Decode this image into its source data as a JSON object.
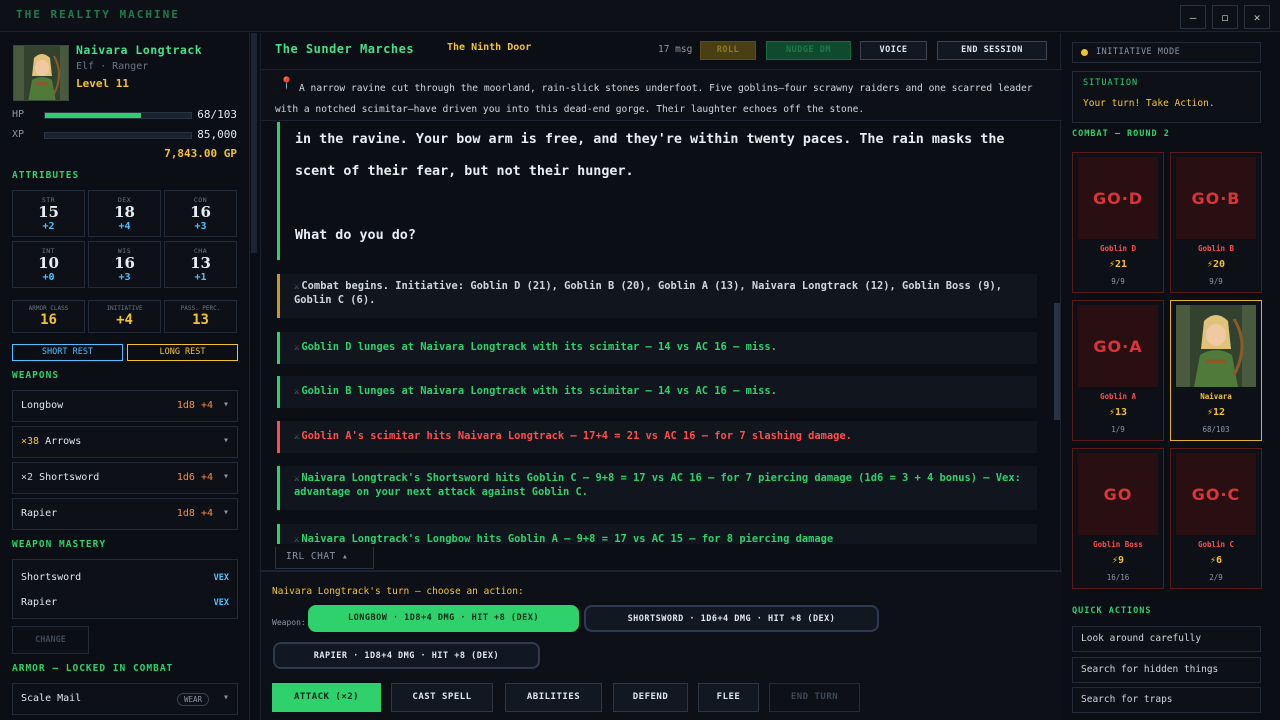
{
  "window": {
    "title": "THE REALITY MACHINE",
    "min_label": "—",
    "max_label": "◻",
    "close_label": "✕"
  },
  "character": {
    "name": "Naivara Longtrack",
    "subtitle": "Elf · Ranger",
    "level": "Level 11",
    "hp_label": "HP",
    "hp_value": "68/103",
    "hp_fraction": 0.66,
    "xp_label": "XP",
    "xp_value": "85,000",
    "xp_fraction": 0.0,
    "gold": "7,843.00 GP"
  },
  "attributes": {
    "section": "ATTRIBUTES",
    "items": [
      {
        "label": "STR",
        "value": "15",
        "mod": "+2"
      },
      {
        "label": "DEX",
        "value": "18",
        "mod": "+4"
      },
      {
        "label": "CON",
        "value": "16",
        "mod": "+3"
      },
      {
        "label": "INT",
        "value": "10",
        "mod": "+0"
      },
      {
        "label": "WIS",
        "value": "16",
        "mod": "+3"
      },
      {
        "label": "CHA",
        "value": "13",
        "mod": "+1"
      }
    ],
    "defense": [
      {
        "label": "ARMOR CLASS",
        "value": "16"
      },
      {
        "label": "INITIATIVE",
        "value": "+4"
      },
      {
        "label": "PASS. PERC.",
        "value": "13"
      }
    ]
  },
  "rest": {
    "short": "SHORT REST",
    "long": "LONG REST"
  },
  "weapons": {
    "section": "WEAPONS",
    "items": [
      {
        "qty": "",
        "name": "Longbow",
        "dmg": "1d8 +4"
      },
      {
        "qty": "×38",
        "name": "Arrows",
        "dmg": ""
      },
      {
        "qty": "×2",
        "name": "Shortsword",
        "dmg": "1d6 +4"
      },
      {
        "qty": "",
        "name": "Rapier",
        "dmg": "1d8 +4"
      }
    ],
    "chevron": "▾"
  },
  "mastery": {
    "section": "WEAPON MASTERY",
    "items": [
      {
        "name": "Shortsword",
        "value": "VEX"
      },
      {
        "name": "Rapier",
        "value": "VEX"
      }
    ],
    "change": "CHANGE"
  },
  "armor": {
    "section": "ARMOR — LOCKED IN COMBAT",
    "name": "Scale Mail",
    "badge": "WEAR",
    "chevron": "▾"
  },
  "session": {
    "campaign": "The Sunder Marches",
    "chapter": "The Ninth Door",
    "msg_count": "17 msg",
    "roll": "ROLL",
    "nudge": "NUDGE DM",
    "voice": "VOICE",
    "end": "END SESSION"
  },
  "scene": {
    "pin": "📍",
    "text": "A narrow ravine cut through the moorland, rain-slick stones underfoot. Five goblins—four scrawny raiders and one scarred leader with a notched scimitar—have driven you into this dead-end gorge. Their laughter echoes off the stone."
  },
  "narration": {
    "line1": "in the ravine. Your bow arm is free, and they're within twenty paces. The rain masks the",
    "line2": "scent of their fear, but not their hunger.",
    "line3": "What do you do?"
  },
  "log": [
    {
      "icon": "⚔",
      "text": "Combat begins. Initiative: Goblin D (21), Goblin B (20), Goblin A (13), Naivara Longtrack (12), Goblin Boss (9), Goblin C (6)."
    },
    {
      "icon": "⚔",
      "text": "Goblin D lunges at Naivara Longtrack with its scimitar — 14 vs AC 16 — miss."
    },
    {
      "icon": "⚔",
      "text": "Goblin B lunges at Naivara Longtrack with its scimitar — 14 vs AC 16 — miss."
    },
    {
      "icon": "⚔",
      "text": "Goblin A's scimitar hits Naivara Longtrack — 17+4 = 21 vs AC 16 — for 7 slashing damage."
    },
    {
      "icon": "⚔",
      "text": "Naivara Longtrack's Shortsword hits Goblin C — 9+8 = 17 vs AC 16 — for 7 piercing damage (1d6 = 3 + 4 bonus) — Vex: advantage on your next attack against Goblin C."
    },
    {
      "icon": "⚔",
      "text": "Naivara Longtrack's Longbow hits Goblin A — 9+8 = 17 vs AC 15 — for 8 piercing damage"
    }
  ],
  "irl_chat": "IRL CHAT  ▴",
  "actions": {
    "turn_label": "Naivara Longtrack's turn — choose an action:",
    "weapon_label": "Weapon:",
    "weapons": [
      "LONGBOW · 1D8+4 DMG · HIT +8 (DEX)",
      "SHORTSWORD · 1D6+4 DMG · HIT +8 (DEX)",
      "RAPIER · 1D8+4 DMG · HIT +8 (DEX)"
    ],
    "buttons": {
      "attack": "ATTACK (×2)",
      "cast": "CAST SPELL",
      "abilities": "ABILITIES",
      "defend": "DEFEND",
      "flee": "FLEE",
      "end_turn": "END TURN"
    }
  },
  "right": {
    "init_mode": "INITIATIVE MODE",
    "situation_label": "SITUATION",
    "situation_text": "Your turn! Take Action.",
    "combat_label": "COMBAT — ROUND 2",
    "combatants": [
      {
        "art": "GO·D",
        "name": "Goblin D",
        "init": "⚡21",
        "hp": "9/9"
      },
      {
        "art": "GO·B",
        "name": "Goblin B",
        "init": "⚡20",
        "hp": "9/9"
      },
      {
        "art": "GO·A",
        "name": "Goblin A",
        "init": "⚡13",
        "hp": "1/9"
      },
      {
        "art": "",
        "name": "Naivara",
        "init": "⚡12",
        "hp": "68/103"
      },
      {
        "art": "GO",
        "name": "Goblin Boss",
        "init": "⚡9",
        "hp": "16/16"
      },
      {
        "art": "GO·C",
        "name": "Goblin C",
        "init": "⚡6",
        "hp": "2/9"
      }
    ],
    "quick_label": "QUICK ACTIONS",
    "quick": [
      "Look around carefully",
      "Search for hidden things",
      "Search for traps"
    ]
  },
  "colors": {
    "accent_green": "#2ed16b",
    "gold": "#f2c230",
    "danger": "#ff4d4d",
    "info": "#4cc3ff"
  }
}
